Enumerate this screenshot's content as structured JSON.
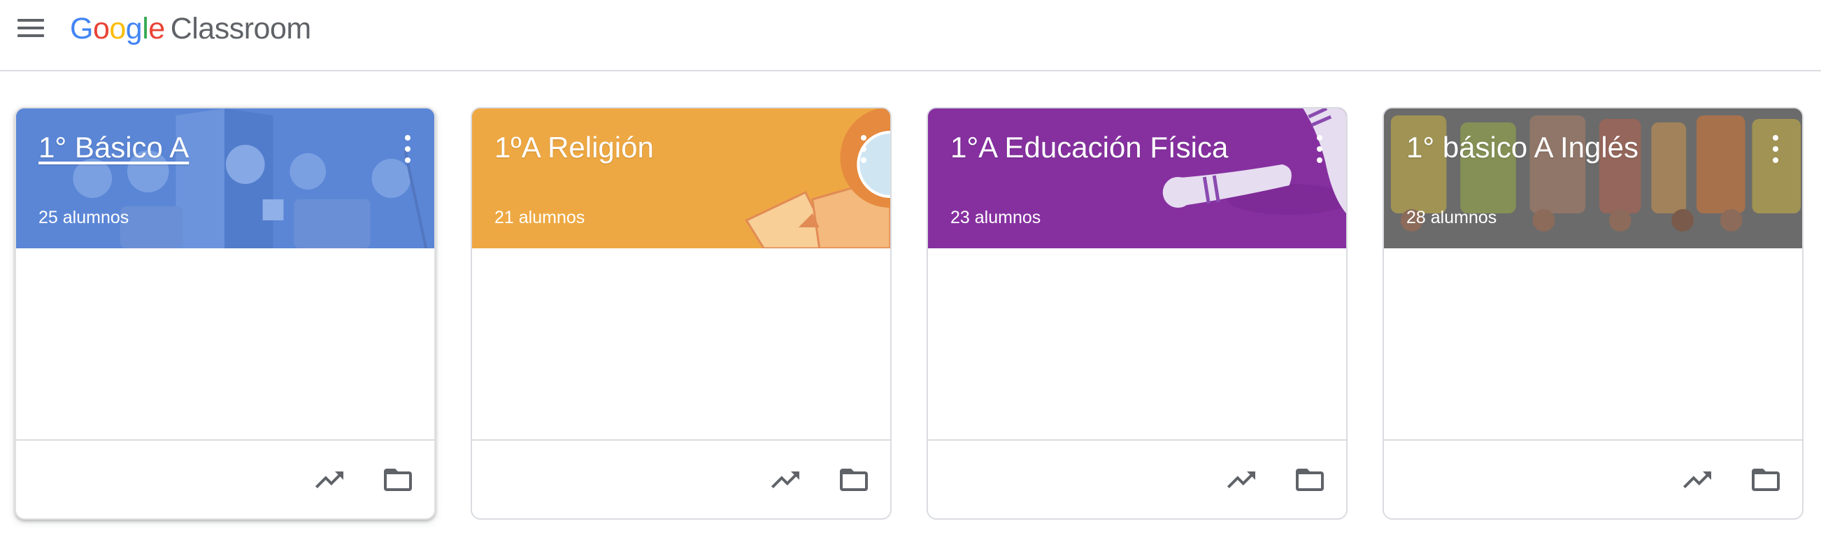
{
  "app": {
    "google_word": [
      "G",
      "o",
      "o",
      "g",
      "l",
      "e"
    ],
    "google_colors": [
      "#4285F4",
      "#EA4335",
      "#FBBC05",
      "#4285F4",
      "#34A853",
      "#EA4335"
    ],
    "product_name": "Classroom"
  },
  "icons": {
    "menu": "hamburger-menu-icon",
    "more": "more-vert-icon",
    "trend": "trending-up-icon",
    "folder": "folder-icon"
  },
  "courses": [
    {
      "title": "1° Básico A",
      "students": "25 alumnos",
      "header_color": "#5b86d6",
      "theme": "illustrated-classroom-kids",
      "underlined": true
    },
    {
      "title": "1ºA Religión",
      "students": "21 alumnos",
      "header_color": "#eea843",
      "theme": "book-and-globe"
    },
    {
      "title": "1°A Educación Física",
      "students": "23 alumnos",
      "header_color": "#8630a0",
      "theme": "bowling-pins"
    },
    {
      "title": "1° básico A Inglés",
      "students": "28 alumnos",
      "header_color": "#6b6b6b",
      "theme": "english-letters-kids"
    }
  ]
}
